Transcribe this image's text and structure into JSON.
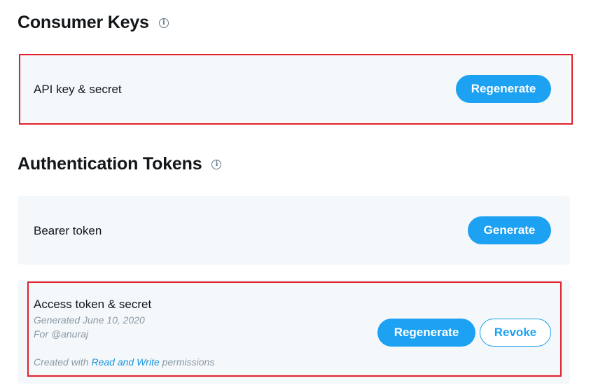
{
  "consumer": {
    "title": "Consumer Keys",
    "item_label": "API key & secret",
    "button": "Regenerate"
  },
  "auth": {
    "title": "Authentication Tokens",
    "bearer": {
      "label": "Bearer token",
      "button": "Generate"
    },
    "access": {
      "label": "Access token & secret",
      "generated": "Generated June 10, 2020",
      "for": "For @anuraj",
      "created_prefix": "Created with",
      "created_link": "Read and Write",
      "created_suffix": "permissions",
      "regenerate_button": "Regenerate",
      "revoke_button": "Revoke"
    }
  },
  "colors": {
    "accent": "#1da1f2",
    "highlight": "#e0202a",
    "card_bg": "#f5f8fa"
  }
}
